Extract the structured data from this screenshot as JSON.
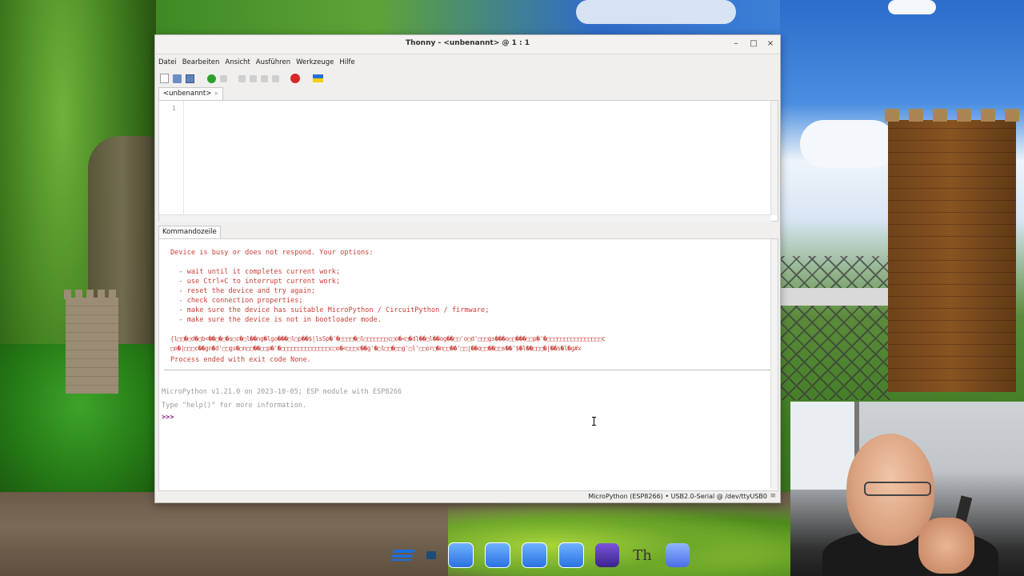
{
  "window": {
    "title": "Thonny  -  <unbenannt>  @  1 : 1",
    "controls": {
      "minimize": "–",
      "maximize": "□",
      "close": "×"
    }
  },
  "menu": [
    "Datei",
    "Bearbeiten",
    "Ansicht",
    "Ausführen",
    "Werkzeuge",
    "Hilfe"
  ],
  "toolbar": {
    "icons": [
      "new-file-icon",
      "open-file-icon",
      "save-file-icon",
      "run-icon",
      "debug-icon",
      "step-over-icon",
      "step-into-icon",
      "step-out-icon",
      "resume-icon",
      "stop-icon",
      "ukraine-flag-icon"
    ],
    "stop_label": "STOP"
  },
  "editor": {
    "tab_label": "<unbenannt>",
    "tab_close": "×",
    "line_numbers": [
      "1"
    ]
  },
  "shell": {
    "tab_label": "Kommandozeile",
    "error_lines": [
      "Device is busy or does not respond. Your options:",
      "",
      "  - wait until it completes current work;",
      "  - use Ctrl+C to interrupt current work;",
      "  - reset the device and try again;",
      "  - check connection properties;",
      "  - make sure the device has suitable MicroPython / CircuitPython / firmware;",
      "  - make sure the device is not in bootloader mode."
    ],
    "garbage_line_1": "{l□□�□d�□b<��□�□�s□c�□l��ng�lgo���□l□p��$|lsSp�'�□□□□�□l□□□□□□□c□o�<□�dl��□l��og��□□'o□d'□□□gs���o□□���□□p�'�□□□□□□□□□□□□□□□□c",
    "garbage_line_2": "□o�|□□□c��gn�d'□□gs�□n□□��□□p�'�□□□□□□□□□□□□□□c□o�<□□□c��g'�□l□□�□□g'□l'□□or□�n□□��'□□|��o□□��□□s��'$�l��□□□�|��s�l�g#x",
    "process_end": "Process ended with exit code None.",
    "info_line_1": "MicroPython v1.21.0 on 2023-10-05; ESP module with ESP8266",
    "info_line_2": "Type \"help()\" for more information.",
    "prompt": ">>>"
  },
  "statusbar": {
    "text": "MicroPython (ESP8266)  •  USB2.0-Serial @ /dev/ttyUSB0",
    "grip": "≡"
  },
  "dock": {
    "items": [
      "zorin-menu-icon",
      "terminal-icon",
      "backup-icon",
      "files-icon",
      "software-icon",
      "password-icon",
      "obsidian-icon",
      "thonny-icon",
      "video-call-icon"
    ],
    "thonny_glyph": "Th"
  }
}
